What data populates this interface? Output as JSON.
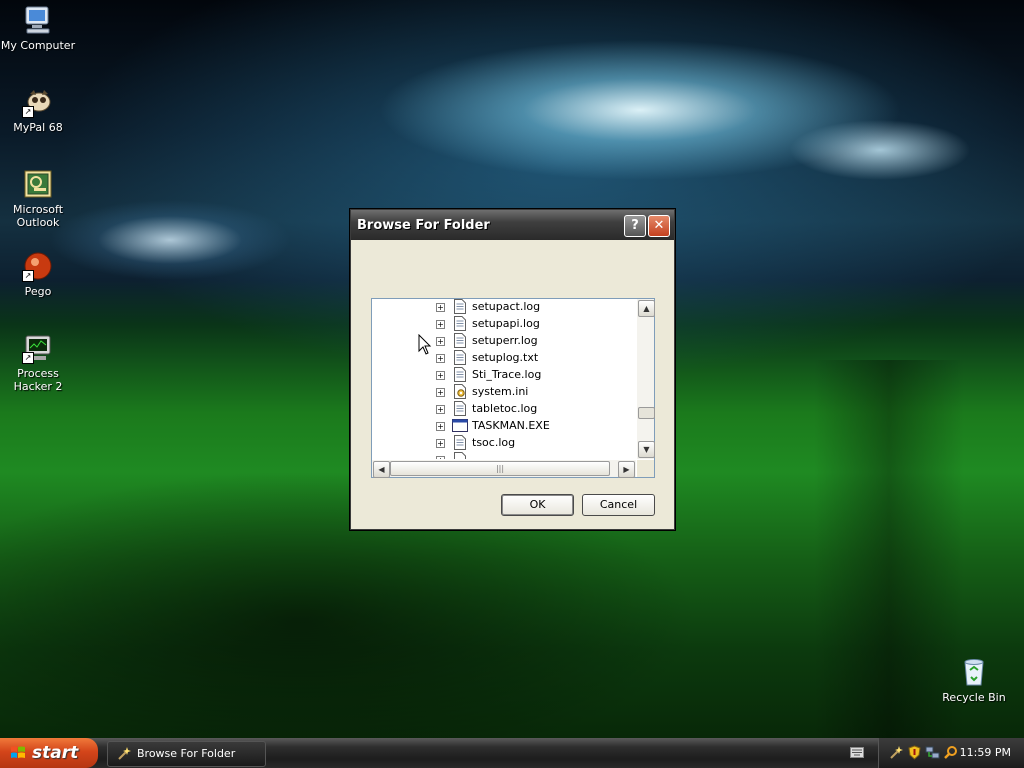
{
  "desktop": {
    "icons": [
      {
        "label": "My Computer"
      },
      {
        "label": "MyPal 68"
      },
      {
        "label": "Microsoft Outlook"
      },
      {
        "label": "Pego"
      },
      {
        "label": "Process Hacker 2"
      },
      {
        "label": "Recycle Bin"
      }
    ]
  },
  "dialog": {
    "title": "Browse For Folder",
    "help_label": "?",
    "close_label": "✕",
    "tree_items": [
      {
        "label": "setupact.log",
        "icon": "text-file-icon"
      },
      {
        "label": "setupapi.log",
        "icon": "text-file-icon"
      },
      {
        "label": "setuperr.log",
        "icon": "text-file-icon"
      },
      {
        "label": "setuplog.txt",
        "icon": "text-file-icon"
      },
      {
        "label": "Sti_Trace.log",
        "icon": "text-file-icon"
      },
      {
        "label": "system.ini",
        "icon": "ini-file-icon"
      },
      {
        "label": "tabletoc.log",
        "icon": "text-file-icon"
      },
      {
        "label": "TASKMAN.EXE",
        "icon": "exe-file-icon"
      },
      {
        "label": "tsoc.log",
        "icon": "text-file-icon"
      }
    ],
    "ok_label": "OK",
    "cancel_label": "Cancel"
  },
  "taskbar": {
    "start_label": "start",
    "task_button_label": "Browse For Folder",
    "clock": "11:59 PM"
  }
}
